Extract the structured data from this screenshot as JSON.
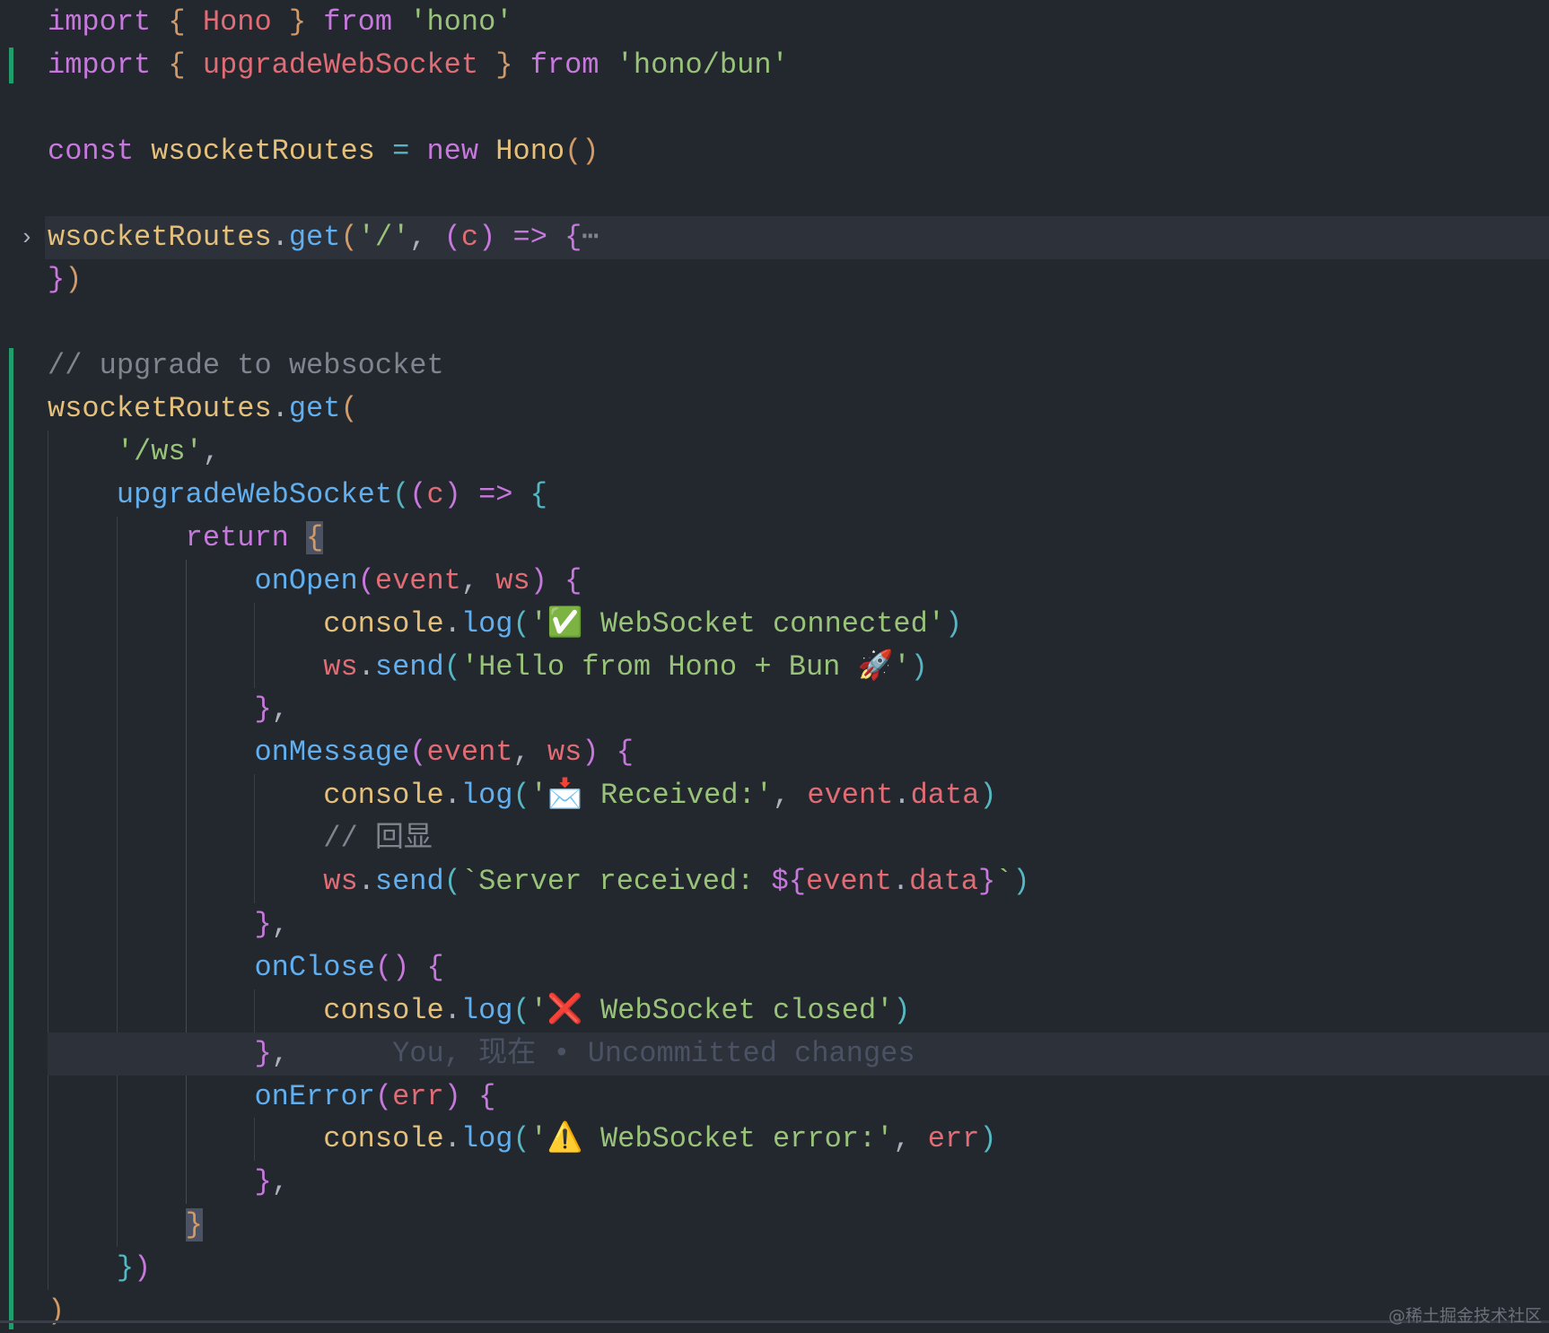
{
  "editor": {
    "lines": [
      [
        [
          "import",
          "k"
        ],
        [
          " { ",
          "o"
        ],
        [
          "Hono",
          "r"
        ],
        [
          " } ",
          "o"
        ],
        [
          "from",
          "k"
        ],
        [
          " ",
          "p"
        ],
        [
          "'hono'",
          "s"
        ]
      ],
      [
        [
          "import",
          "k"
        ],
        [
          " { ",
          "o"
        ],
        [
          "upgradeWebSocket",
          "r"
        ],
        [
          " } ",
          "o"
        ],
        [
          "from",
          "k"
        ],
        [
          " ",
          "p"
        ],
        [
          "'hono/bun'",
          "s"
        ]
      ],
      [],
      [
        [
          "const",
          "k"
        ],
        [
          " ",
          "p"
        ],
        [
          "wsocketRoutes",
          "v"
        ],
        [
          " = ",
          "c"
        ],
        [
          "new",
          "k"
        ],
        [
          " ",
          "p"
        ],
        [
          "Hono",
          "v"
        ],
        [
          "()",
          "o"
        ]
      ],
      [],
      [
        [
          "wsocketRoutes",
          "v"
        ],
        [
          ".",
          "p"
        ],
        [
          "get",
          "f"
        ],
        [
          "(",
          "o"
        ],
        [
          "'/'",
          "s"
        ],
        [
          ", ",
          "p"
        ],
        [
          "(",
          "k"
        ],
        [
          "c",
          "r"
        ],
        [
          ")",
          "k"
        ],
        [
          " => ",
          "k"
        ],
        [
          "{",
          "k"
        ],
        [
          "⋯",
          "fold"
        ]
      ],
      [
        [
          "}",
          "k"
        ],
        [
          ")",
          "o"
        ]
      ],
      [],
      [
        [
          "// upgrade to websocket",
          "cm"
        ]
      ],
      [
        [
          "wsocketRoutes",
          "v"
        ],
        [
          ".",
          "p"
        ],
        [
          "get",
          "f"
        ],
        [
          "(",
          "o"
        ]
      ],
      [
        [
          "    ",
          "p"
        ],
        [
          "'/ws'",
          "s"
        ],
        [
          ",",
          "p"
        ]
      ],
      [
        [
          "    ",
          "p"
        ],
        [
          "upgradeWebSocket",
          "f"
        ],
        [
          "(",
          "c"
        ],
        [
          "(",
          "k"
        ],
        [
          "c",
          "r"
        ],
        [
          ")",
          "k"
        ],
        [
          " => ",
          "k"
        ],
        [
          "{",
          "c"
        ]
      ],
      [
        [
          "        ",
          "p"
        ],
        [
          "return",
          "k"
        ],
        [
          " ",
          "p"
        ],
        [
          "{",
          "o bm"
        ]
      ],
      [
        [
          "            ",
          "p"
        ],
        [
          "onOpen",
          "f"
        ],
        [
          "(",
          "k"
        ],
        [
          "event",
          "r"
        ],
        [
          ", ",
          "p"
        ],
        [
          "ws",
          "r"
        ],
        [
          ")",
          "k"
        ],
        [
          " {",
          "k"
        ]
      ],
      [
        [
          "                ",
          "p"
        ],
        [
          "console",
          "v"
        ],
        [
          ".",
          "p"
        ],
        [
          "log",
          "f"
        ],
        [
          "(",
          "c"
        ],
        [
          "'✅ WebSocket connected'",
          "s"
        ],
        [
          ")",
          "c"
        ]
      ],
      [
        [
          "                ",
          "p"
        ],
        [
          "ws",
          "r"
        ],
        [
          ".",
          "p"
        ],
        [
          "send",
          "f"
        ],
        [
          "(",
          "c"
        ],
        [
          "'Hello from Hono + Bun 🚀'",
          "s"
        ],
        [
          ")",
          "c"
        ]
      ],
      [
        [
          "            ",
          "p"
        ],
        [
          "}",
          "k"
        ],
        [
          ",",
          "p"
        ]
      ],
      [
        [
          "            ",
          "p"
        ],
        [
          "onMessage",
          "f"
        ],
        [
          "(",
          "k"
        ],
        [
          "event",
          "r"
        ],
        [
          ", ",
          "p"
        ],
        [
          "ws",
          "r"
        ],
        [
          ")",
          "k"
        ],
        [
          " {",
          "k"
        ]
      ],
      [
        [
          "                ",
          "p"
        ],
        [
          "console",
          "v"
        ],
        [
          ".",
          "p"
        ],
        [
          "log",
          "f"
        ],
        [
          "(",
          "c"
        ],
        [
          "'📩 Received:'",
          "s"
        ],
        [
          ", ",
          "p"
        ],
        [
          "event",
          "r"
        ],
        [
          ".",
          "p"
        ],
        [
          "data",
          "r"
        ],
        [
          ")",
          "c"
        ]
      ],
      [
        [
          "                ",
          "p"
        ],
        [
          "// 回显",
          "cm"
        ]
      ],
      [
        [
          "                ",
          "p"
        ],
        [
          "ws",
          "r"
        ],
        [
          ".",
          "p"
        ],
        [
          "send",
          "f"
        ],
        [
          "(",
          "c"
        ],
        [
          "`Server received: ",
          "s"
        ],
        [
          "${",
          "k"
        ],
        [
          "event",
          "r"
        ],
        [
          ".",
          "p"
        ],
        [
          "data",
          "r"
        ],
        [
          "}",
          "k"
        ],
        [
          "`",
          "s"
        ],
        [
          ")",
          "c"
        ]
      ],
      [
        [
          "            ",
          "p"
        ],
        [
          "}",
          "k"
        ],
        [
          ",",
          "p"
        ]
      ],
      [
        [
          "            ",
          "p"
        ],
        [
          "onClose",
          "f"
        ],
        [
          "()",
          "k"
        ],
        [
          " {",
          "k"
        ]
      ],
      [
        [
          "                ",
          "p"
        ],
        [
          "console",
          "v"
        ],
        [
          ".",
          "p"
        ],
        [
          "log",
          "f"
        ],
        [
          "(",
          "c"
        ],
        [
          "'❌ WebSocket closed'",
          "s"
        ],
        [
          ")",
          "c"
        ]
      ],
      [
        [
          "            ",
          "p"
        ],
        [
          "}",
          "k"
        ],
        [
          ",",
          "p"
        ],
        [
          "      You, 现在 • Uncommitted changes",
          "blame"
        ]
      ],
      [
        [
          "            ",
          "p"
        ],
        [
          "onError",
          "f"
        ],
        [
          "(",
          "k"
        ],
        [
          "err",
          "r"
        ],
        [
          ")",
          "k"
        ],
        [
          " {",
          "k"
        ]
      ],
      [
        [
          "                ",
          "p"
        ],
        [
          "console",
          "v"
        ],
        [
          ".",
          "p"
        ],
        [
          "log",
          "f"
        ],
        [
          "(",
          "c"
        ],
        [
          "'⚠️ WebSocket error:'",
          "s"
        ],
        [
          ", ",
          "p"
        ],
        [
          "err",
          "r"
        ],
        [
          ")",
          "c"
        ]
      ],
      [
        [
          "            ",
          "p"
        ],
        [
          "}",
          "k"
        ],
        [
          ",",
          "p"
        ]
      ],
      [
        [
          "        ",
          "p"
        ],
        [
          "}",
          "o bm"
        ]
      ],
      [
        [
          "    ",
          "p"
        ],
        [
          "}",
          "c"
        ],
        [
          ")",
          "k"
        ]
      ],
      [
        [
          ")",
          "o"
        ]
      ]
    ],
    "highlighted_lines": [
      5,
      24
    ],
    "folded_line": 5,
    "fold_chevron": "›"
  },
  "watermark": "@稀土掘金技术社区"
}
